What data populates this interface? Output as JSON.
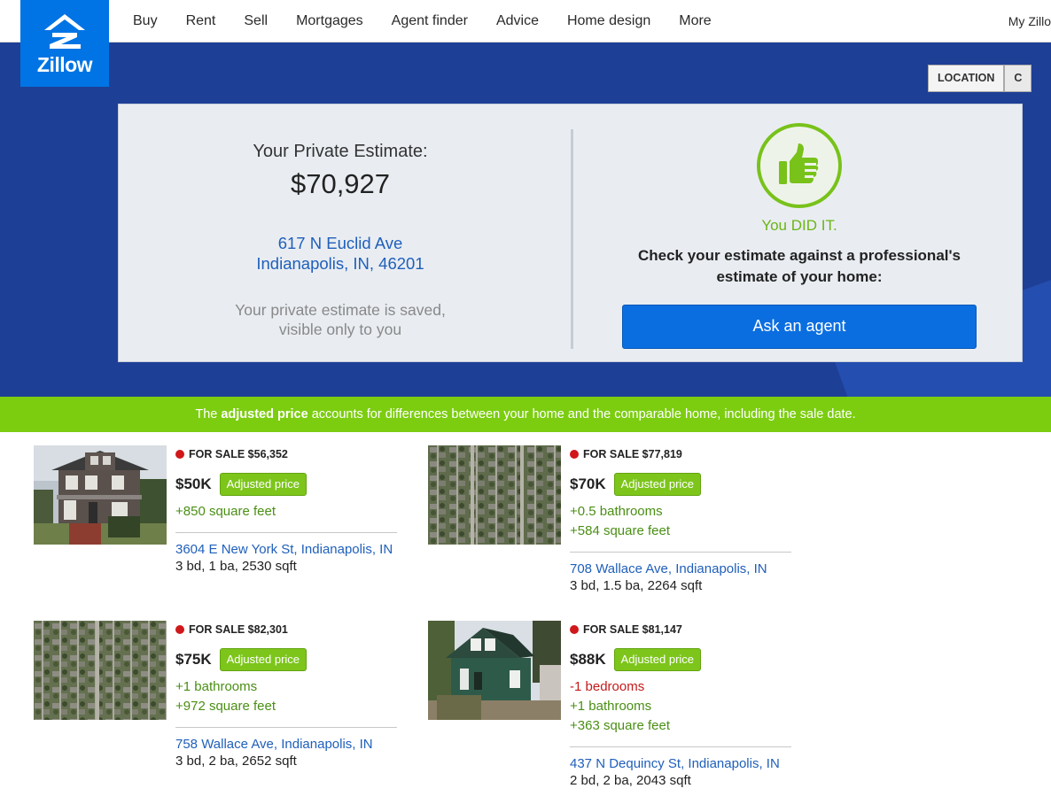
{
  "brand": {
    "name": "Zillow",
    "color": "#0074e4"
  },
  "nav": {
    "items": [
      "Buy",
      "Rent",
      "Sell",
      "Mortgages",
      "Agent finder",
      "Advice",
      "Home design",
      "More"
    ],
    "right": "My Zillo"
  },
  "hero": {
    "tabs": [
      "LOCATION",
      "C"
    ],
    "estimate": {
      "label": "Your Private Estimate:",
      "value": "$70,927",
      "address_line1": "617 N Euclid Ave",
      "address_line2": "Indianapolis, IN, 46201",
      "note_line1": "Your private estimate is saved,",
      "note_line2": "visible only to you"
    },
    "cta": {
      "icon": "thumbs-up-icon",
      "did_it": "You DID IT.",
      "check_line1": "Check your estimate against a professional's",
      "check_line2": "estimate of your home:",
      "button": "Ask an agent"
    }
  },
  "band": {
    "prefix": "The ",
    "bold": "adjusted price",
    "suffix": " accounts for differences between your home and the comparable home, including the sale date."
  },
  "colors": {
    "hero_bg": "#1e3f96",
    "green": "#7ccd10",
    "link": "#1f5fba",
    "status_dot": "#d0181b"
  },
  "comps": [
    {
      "status": "FOR SALE $56,352",
      "price": "$50K",
      "badge": "Adjusted price",
      "diffs": [
        {
          "text": "+850 square feet",
          "negative": false
        }
      ],
      "address": "3604 E New York St, Indianapolis, IN",
      "specs": "3 bd, 1 ba, 2530 sqft",
      "photo": "house-photo"
    },
    {
      "status": "FOR SALE $77,819",
      "price": "$70K",
      "badge": "Adjusted price",
      "diffs": [
        {
          "text": "+0.5 bathrooms",
          "negative": false
        },
        {
          "text": "+584 square feet",
          "negative": false
        }
      ],
      "address": "708 Wallace Ave, Indianapolis, IN",
      "specs": "3 bd, 1.5 ba, 2264 sqft",
      "photo": "aerial-photo"
    },
    {
      "status": "FOR SALE $82,301",
      "price": "$75K",
      "badge": "Adjusted price",
      "diffs": [
        {
          "text": "+1 bathrooms",
          "negative": false
        },
        {
          "text": "+972 square feet",
          "negative": false
        }
      ],
      "address": "758 Wallace Ave, Indianapolis, IN",
      "specs": "3 bd, 2 ba, 2652 sqft",
      "photo": "aerial-photo"
    },
    {
      "status": "FOR SALE $81,147",
      "price": "$88K",
      "badge": "Adjusted price",
      "diffs": [
        {
          "text": "-1 bedrooms",
          "negative": true
        },
        {
          "text": "+1 bathrooms",
          "negative": false
        },
        {
          "text": "+363 square feet",
          "negative": false
        }
      ],
      "address": "437 N Dequincy St, Indianapolis, IN",
      "specs": "2 bd, 2 ba, 2043 sqft",
      "photo": "house-photo"
    }
  ]
}
